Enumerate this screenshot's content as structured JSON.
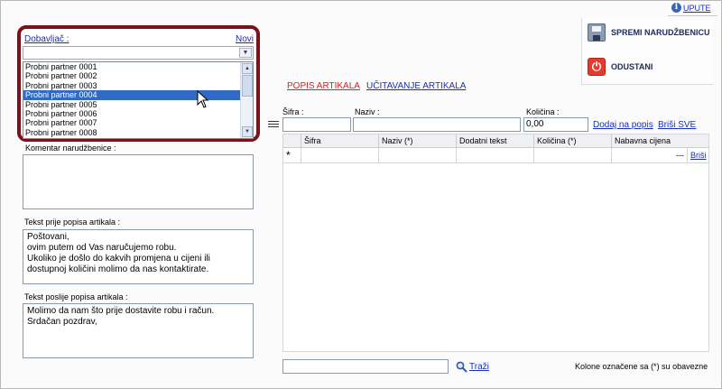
{
  "header": {
    "help_label": "UPUTE"
  },
  "actions": {
    "save_label": "SPREMI NARUDŽBENICU",
    "cancel_label": "ODUSTANI"
  },
  "supplier": {
    "label": "Dobavljač :",
    "new_link": "Novi",
    "selected_value": "",
    "options": [
      "Probni partner 0001",
      "Probni partner 0002",
      "Probni partner 0003",
      "Probni partner 0004",
      "Probni partner 0005",
      "Probni partner 0006",
      "Probni partner 0007",
      "Probni partner 0008"
    ],
    "highlighted_index": 3
  },
  "comment": {
    "label": "Komentar narudžbenice :",
    "value": ""
  },
  "text_before": {
    "label": "Tekst prije popisa artikala :",
    "value": "Poštovani,\novim putem od Vas naručujemo robu.\nUkoliko je došlo do kakvih promjena u cijeni ili\ndostupnoj količini molimo da nas kontaktirate."
  },
  "text_after": {
    "label": "Tekst poslije popisa artikala :",
    "value": "Molimo da nam što prije dostavite robu i račun.\nSrdačan pozdrav,"
  },
  "tabs": {
    "items_list": "POPIS ARTIKALA",
    "items_import": "UČITAVANJE ARTIKALA"
  },
  "entry": {
    "sifra_label": "Šifra :",
    "sifra_value": "",
    "naziv_label": "Naziv :",
    "naziv_value": "",
    "kolicina_label": "Količina :",
    "kolicina_value": "0,00",
    "add_link": "Dodaj na popis",
    "delete_all_link": "Briši SVE"
  },
  "grid": {
    "columns": [
      "Šifra",
      "Naziv (*)",
      "Dodatni tekst",
      "Količina (*)",
      "Nabavna cijena"
    ],
    "new_row": {
      "marker": "*",
      "price": "---",
      "delete_link": "Briši"
    }
  },
  "search": {
    "value": "",
    "button_label": "Traži"
  },
  "footer_note": "Kolone označene sa (*) su obavezne"
}
